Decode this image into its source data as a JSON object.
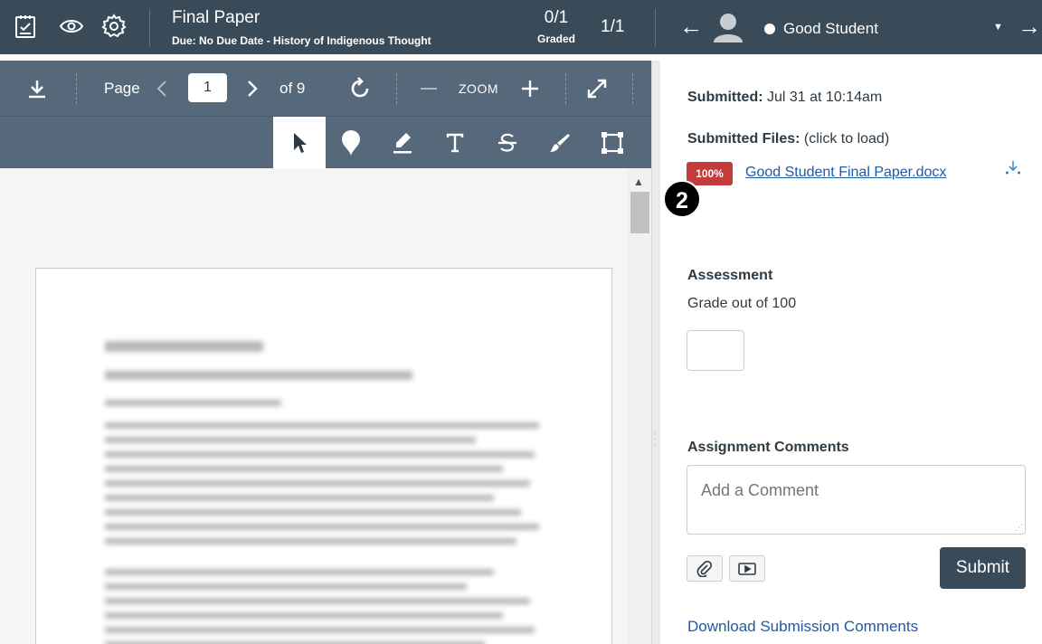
{
  "header": {
    "title": "Final Paper",
    "due": "Due: No Due Date",
    "course": "History of Indigenous Thought",
    "grade_value": "0/1",
    "grade_label": "Graded",
    "count": "1/1",
    "prev_arrow": "←",
    "next_arrow": "→",
    "student_name": "Good Student",
    "caret": "▼"
  },
  "viewer": {
    "page_label": "Page",
    "page_value": "1",
    "page_of": "of 9",
    "zoom_label": "ZOOM",
    "scroll_up": "▲",
    "active_tool": "select"
  },
  "panel": {
    "submitted_label": "Submitted:",
    "submitted_value": "Jul 31 at 10:14am",
    "files_label": "Submitted Files:",
    "files_hint": "(click to load)",
    "file_badge": "100%",
    "file_name": "Good Student Final Paper.docx",
    "callout": "2",
    "assessment_label": "Assessment",
    "grade_out_of": "Grade out of 100",
    "comments_label": "Assignment Comments",
    "comment_placeholder": "Add a Comment",
    "submit_label": "Submit",
    "download_comments": "Download Submission Comments"
  },
  "colors": {
    "header_bg": "#394b58",
    "toolbar_bg": "#56697a",
    "badge_red": "#c23c3c",
    "link_blue": "#1f5aa5"
  }
}
